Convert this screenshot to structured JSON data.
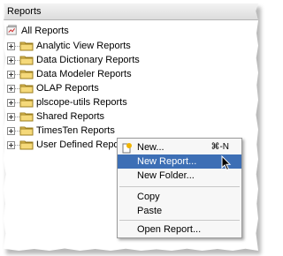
{
  "panel": {
    "title": "Reports"
  },
  "tree": {
    "root": "All Reports",
    "items": [
      "Analytic View Reports",
      "Data Dictionary Reports",
      "Data Modeler Reports",
      "OLAP Reports",
      "plscope-utils Reports",
      "Shared Reports",
      "TimesTen Reports",
      "User Defined Reports"
    ]
  },
  "context_menu": {
    "items": [
      {
        "label": "New...",
        "shortcut": "⌘-N"
      },
      {
        "label": "New Report..."
      },
      {
        "label": "New Folder..."
      },
      {
        "label": "Copy"
      },
      {
        "label": "Paste"
      },
      {
        "label": "Open Report..."
      }
    ],
    "highlighted": "New Report..."
  }
}
